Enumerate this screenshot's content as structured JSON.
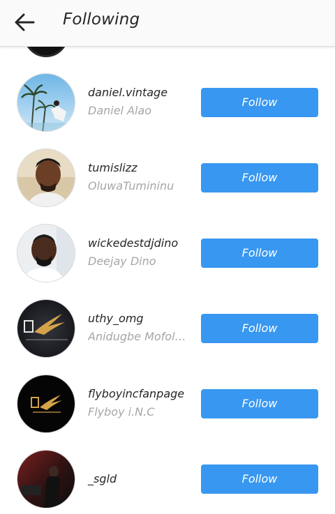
{
  "header": {
    "title": "Following",
    "back_icon": "arrow-left-icon"
  },
  "colors": {
    "follow_button": "#3897f0",
    "follow_text": "#ffffff",
    "username_text": "#262626",
    "fullname_text": "#a6a6a6",
    "header_bg": "#fafafa"
  },
  "users": [
    {
      "username": "daniel.vintage",
      "fullname": "Daniel Alao",
      "button_label": "Follow",
      "avatar": "palm-trees-photo"
    },
    {
      "username": "tumislizz",
      "fullname": "OluwaTumininu",
      "button_label": "Follow",
      "avatar": "portrait-photo"
    },
    {
      "username": "wickedestdjdino",
      "fullname": "Deejay Dino",
      "button_label": "Follow",
      "avatar": "portrait-photo"
    },
    {
      "username": "uthy_omg",
      "fullname": "Anidugbe Mofoluwaso",
      "button_label": "Follow",
      "avatar": "flyboy-logo"
    },
    {
      "username": "flyboyincfanpage",
      "fullname": "Flyboy i.N.C",
      "button_label": "Follow",
      "avatar": "flyboy-logo"
    },
    {
      "username": "_sgld",
      "fullname": "",
      "button_label": "Follow",
      "avatar": "dark-room-photo"
    }
  ]
}
